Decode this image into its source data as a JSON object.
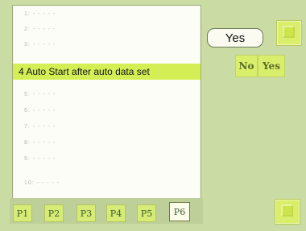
{
  "list": {
    "items": [
      {
        "label": "1: - - - - -"
      },
      {
        "label": "2: - - - - -"
      },
      {
        "label": "3: - - - - -"
      },
      {
        "label": "4 Auto Start after auto data set"
      },
      {
        "label": "5: - - - - -"
      },
      {
        "label": "6: - - - - -"
      },
      {
        "label": "7: - - - - -"
      },
      {
        "label": "8: - - - - -"
      },
      {
        "label": "9: - - - - -"
      },
      {
        "label": "10: - - - - -"
      }
    ],
    "selected_index": 3
  },
  "value_display": "Yes",
  "options": {
    "no_label": "No",
    "yes_label": "Yes"
  },
  "tabs": [
    {
      "label": "P1"
    },
    {
      "label": "P2"
    },
    {
      "label": "P3"
    },
    {
      "label": "P4"
    },
    {
      "label": "P5"
    },
    {
      "label": "P6"
    }
  ],
  "active_tab": 5,
  "colors": {
    "background": "#cadca4",
    "selection": "#d4ef55",
    "button": "#d9ee6a"
  },
  "icons": {
    "top_button": "return-icon",
    "bottom_button": "confirm-icon"
  }
}
